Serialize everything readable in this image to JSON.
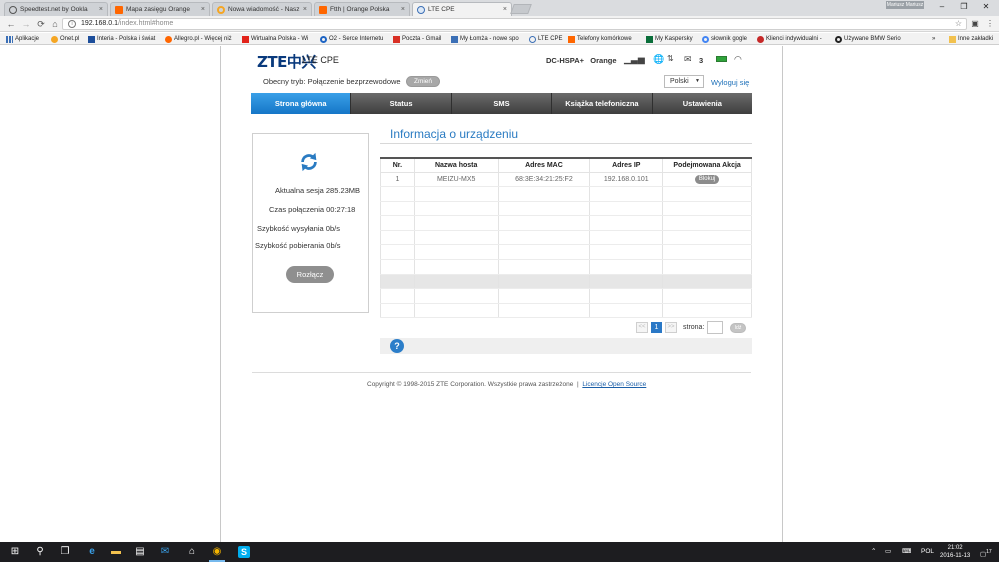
{
  "browser": {
    "tabs": [
      {
        "title": "Speedtest.net by Ookla",
        "active": false
      },
      {
        "title": "Mapa zasięgu Orange",
        "active": false
      },
      {
        "title": "Nowa wiadomość - Nasz",
        "active": false
      },
      {
        "title": "Ftth | Orange Polska",
        "active": false
      },
      {
        "title": "LTE CPE",
        "active": true
      }
    ],
    "close_glyph": "×",
    "user_button": "Mariusz Mariusz",
    "url_host": "192.168.0.1",
    "url_path": "/index.html#home",
    "bookmarks": [
      "Aplikacje",
      "Onet.pl",
      "Interia - Polska i świat",
      "Allegro.pl - Więcej niż",
      "Wirtualna Polska - Wi",
      "O2 - Serce Internetu",
      "Poczta - Gmail",
      "My Łomża - nowe spo",
      "LTE CPE",
      "Telefony komórkowe",
      "My Kaspersky",
      "słownik gogle",
      "Klienci indywidualni -",
      "Używane BMW Serio",
      "»",
      "Inne zakładki"
    ]
  },
  "header": {
    "logo": "ZTE中兴",
    "product": "LTE CPE",
    "network_type": "DC-HSPA+",
    "operator": "Orange",
    "message_count": "3",
    "mode_label": "Obecny tryb: Połączenie bezprzewodowe",
    "change_button": "Zmień",
    "language": "Polski",
    "logout": "Wyloguj się"
  },
  "menu": {
    "items": [
      "Strona główna",
      "Status",
      "SMS",
      "Książka telefoniczna",
      "Ustawienia"
    ]
  },
  "connection": {
    "session": "Aktualna sesja 285.23MB",
    "time": "Czas połączenia 00:27:18",
    "upload": "Szybkość wysyłania 0b/s",
    "download": "Szybkość pobierania 0b/s",
    "disconnect_button": "Rozłącz"
  },
  "devices": {
    "title": "Informacja o urządzeniu",
    "columns": [
      "Nr.",
      "Nazwa hosta",
      "Adres MAC",
      "Adres IP",
      "Podejmowana Akcja"
    ],
    "rows": [
      {
        "nr": "1",
        "host": "MEIZU-MX5",
        "mac": "68:3E:34:21:25:F2",
        "ip": "192.168.0.101",
        "action": "Blokuj"
      }
    ],
    "pager": {
      "prev": "<<",
      "current": "1",
      "next": ">>",
      "page_label": "strona:",
      "go_button": "Idź"
    },
    "help": "?"
  },
  "footer": {
    "copyright": "Copyright © 1998-2015 ZTE Corporation. Wszystkie prawa zastrzeżone",
    "separator": "|",
    "link": "Licencje Open Source"
  },
  "taskbar": {
    "lang": "POL",
    "time": "21:02",
    "date": "2016-11-13",
    "notif_count": "17"
  },
  "colors": {
    "accent": "#1b6fb8",
    "menu_active": "#1576c7",
    "menu_bg": "#4a4a4a"
  }
}
